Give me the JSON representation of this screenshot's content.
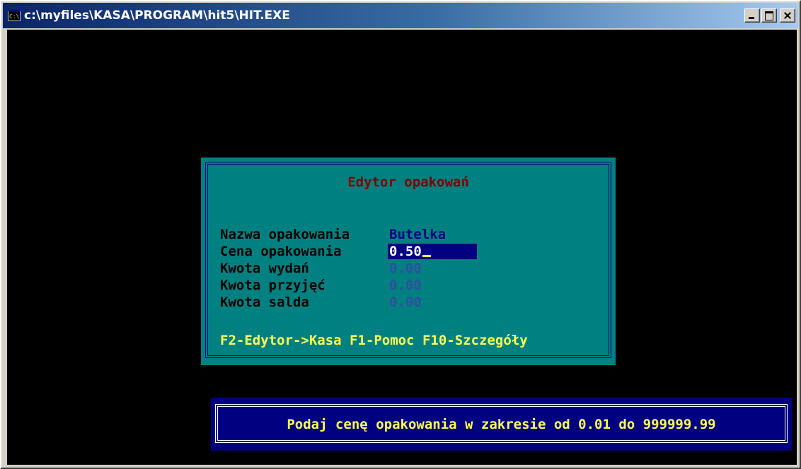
{
  "window": {
    "title": "c:\\myfiles\\KASA\\PROGRAM\\hit5\\HIT.EXE",
    "icon": "console-icon",
    "buttons": [
      "minimize",
      "maximize",
      "close"
    ]
  },
  "dialog": {
    "title": "Edytor opakowań",
    "fields": [
      {
        "label": "Nazwa opakowania",
        "value": "Butelka"
      },
      {
        "label": "Cena opakowania",
        "value": "0.50"
      },
      {
        "label": "Kwota wydań",
        "value": "0.00"
      },
      {
        "label": "Kwota przyjęć",
        "value": "0.00"
      },
      {
        "label": "Kwota salda",
        "value": "0.00"
      }
    ],
    "hotkeys": "F2-Edytor->Kasa F1-Pomoc F10-Szczegóły"
  },
  "status": {
    "message": "Podaj cenę opakowania w zakresie od 0.01 do 999999.99"
  },
  "colors": {
    "console_bg": "#000000",
    "dialog_bg": "#008080",
    "dialog_title": "#800000",
    "input_bg": "#000080",
    "hotkeys": "#ffff55",
    "status_bg": "#000080"
  }
}
